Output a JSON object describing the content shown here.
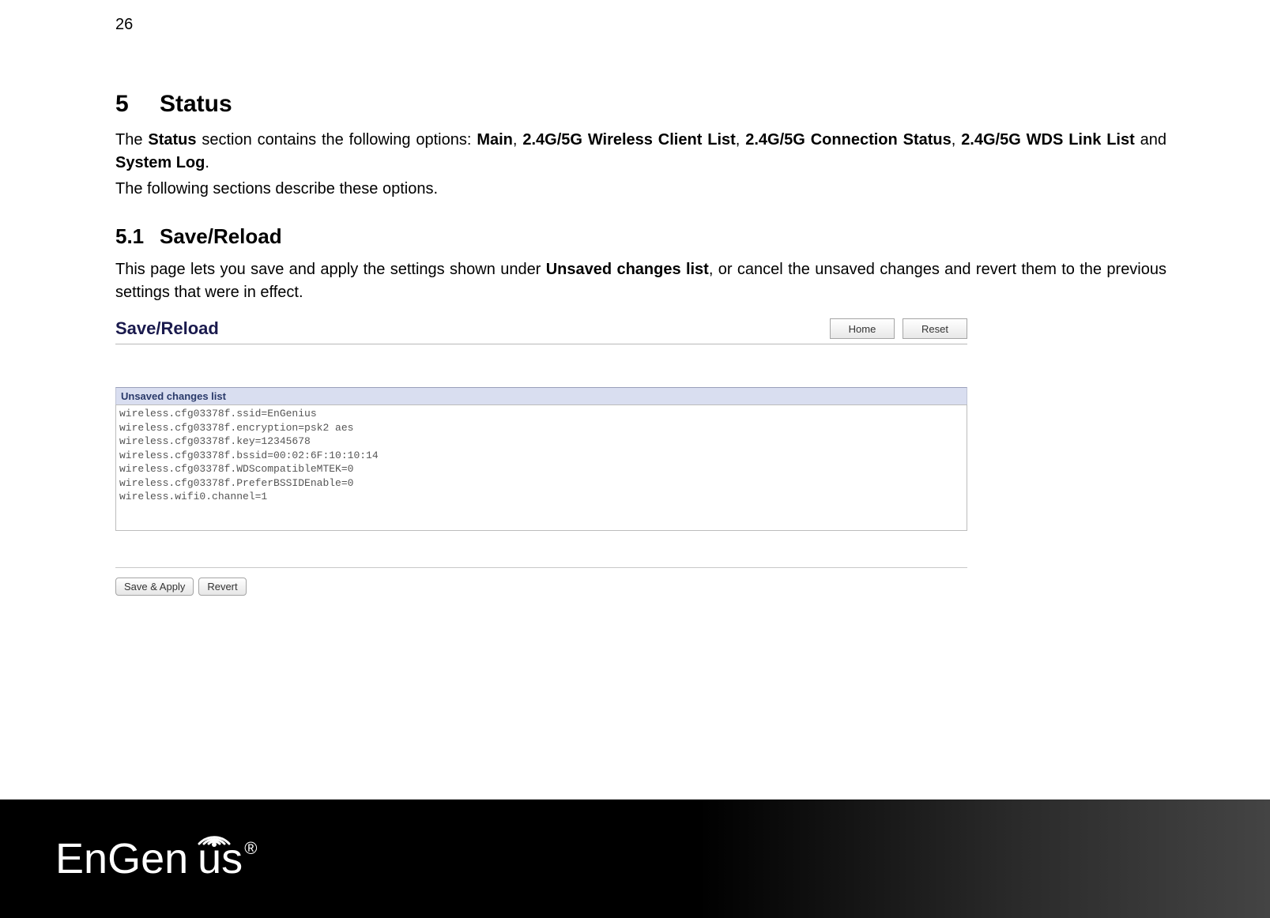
{
  "page_number": "26",
  "section": {
    "number": "5",
    "title": "Status",
    "intro_parts": {
      "t0": "The ",
      "b0": "Status",
      "t1": " section contains the following options: ",
      "b1": "Main",
      "t2": ", ",
      "b2": "2.4G/5G Wireless Client List",
      "t3": ", ",
      "b3": "2.4G/5G Connection Status",
      "t4": ", ",
      "b4": "2.4G/5G WDS Link List",
      "t5": " and ",
      "b5": "System Log",
      "t6": "."
    },
    "intro_followup": "The following sections describe these options."
  },
  "subsection": {
    "number": "5.1",
    "title": "Save/Reload",
    "para_parts": {
      "t0": "This page lets you save and apply the settings shown under ",
      "b0": "Unsaved changes list",
      "t1": ", or cancel the unsaved changes and revert them to the previous settings that were in effect."
    }
  },
  "panel": {
    "title": "Save/Reload",
    "btn_home": "Home",
    "btn_reset": "Reset",
    "section_label": "Unsaved changes list",
    "changes_text": "wireless.cfg03378f.ssid=EnGenius\nwireless.cfg03378f.encryption=psk2 aes\nwireless.cfg03378f.key=12345678\nwireless.cfg03378f.bssid=00:02:6F:10:10:14\nwireless.cfg03378f.WDScompatibleMTEK=0\nwireless.cfg03378f.PreferBSSIDEnable=0\nwireless.wifi0.channel=1",
    "btn_save_apply": "Save & Apply",
    "btn_revert": "Revert"
  },
  "footer": {
    "brand_part1": "En",
    "brand_part2": "Gen",
    "brand_part3": "i",
    "brand_part4": "us",
    "reg": "®"
  }
}
